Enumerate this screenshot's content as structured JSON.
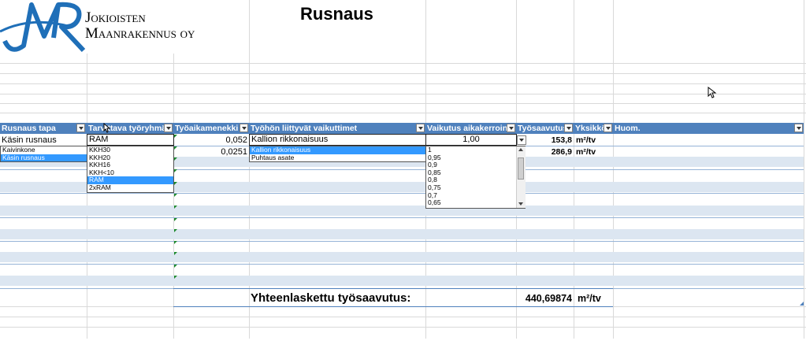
{
  "company": {
    "logo_letters": "JMR",
    "name_line1": "Jokioisten",
    "name_line2": "Maanrakennus oy"
  },
  "sheet_title": "Rusnaus",
  "headers": {
    "col1": "Rusnaus tapa",
    "col2": "Tarvittava työryhmä",
    "col3": "Työaikamenekki",
    "col4": "Työhön liittyvät vaikuttimet",
    "col5": "Vaikutus aikakerroin",
    "col6": "Työsaavutus",
    "col7": "Yksikkö",
    "col8": "Huom."
  },
  "row1": {
    "tapa": "Käsin rusnaus",
    "ryhma": "RAM",
    "menekki": "0,052",
    "vaikutin": "Kallion rikkonaisuus",
    "kerroin": "1,00",
    "saavutus": "153,8",
    "yksikko": "m²/tv"
  },
  "row2": {
    "menekki": "0,0251",
    "saavutus": "286,9",
    "yksikko": "m²/tv"
  },
  "list_tapa": [
    "Kaivinkone",
    "Käsin rusnaus"
  ],
  "list_tapa_selected": 1,
  "list_ryhma": [
    "KKH30",
    "KKH20",
    "KKH16",
    "KKH<10",
    "RAM",
    "2xRAM"
  ],
  "list_ryhma_selected": 4,
  "list_vaikutin": [
    "Kallion rikkonaisuus",
    "Puhtaus asate"
  ],
  "list_vaikutin_selected": 0,
  "list_kerroin": [
    "1",
    "0,95",
    "0,9",
    "0,85",
    "0,8",
    "0,75",
    "0,7",
    "0,65"
  ],
  "total": {
    "label": "Yhteenlaskettu työsaavutus:",
    "value": "440,69874",
    "unit": "m²/tv"
  },
  "colors": {
    "header_blue": "#4f81bd",
    "band_blue": "#dce6f1",
    "logo_blue": "#1f6fb8",
    "select_blue": "#3399ff"
  }
}
